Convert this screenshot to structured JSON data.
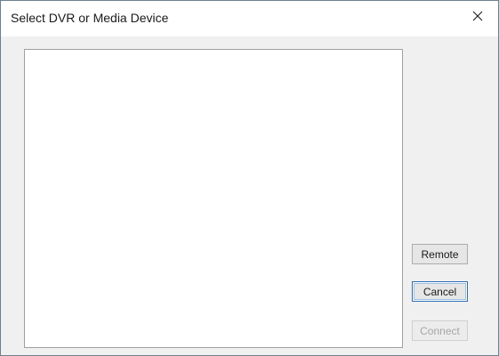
{
  "window": {
    "title": "Select DVR or Media Device"
  },
  "titlebar": {
    "close_icon": "close-icon"
  },
  "device_list": {
    "items": []
  },
  "buttons": {
    "remote_label": "Remote",
    "cancel_label": "Cancel",
    "connect_label": "Connect",
    "connect_enabled": false
  }
}
